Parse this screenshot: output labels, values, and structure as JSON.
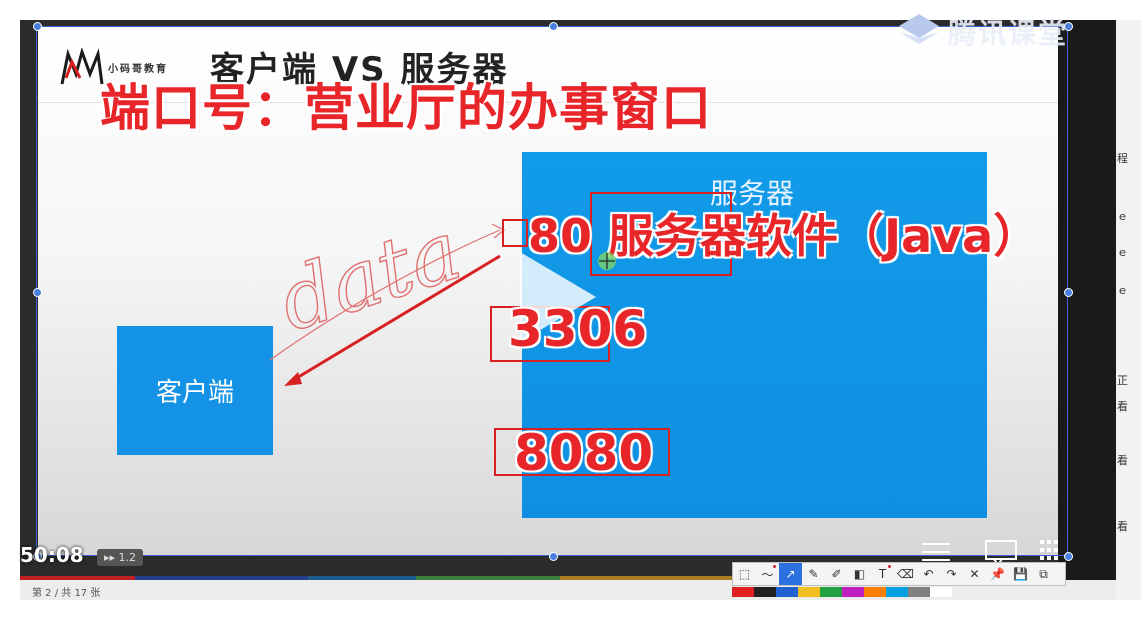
{
  "brand": {
    "name": "腾讯课堂"
  },
  "slide": {
    "logo_text": "小码哥教育",
    "title": "客户端 VS 服务器",
    "client_label": "客户端",
    "server_label": "服务器",
    "handwriting": "data"
  },
  "annotations": {
    "heading": "端口号：营业厅的办事窗口",
    "port_80": "80 服务器软件（Java）",
    "port_3306": "3306",
    "port_8080": "8080"
  },
  "player": {
    "time": "50:08",
    "speed": "▸▸ 1.2",
    "page": "第 2 / 共 17 张"
  },
  "toolbar": {
    "tools": [
      {
        "name": "select-tool",
        "glyph": "⬚"
      },
      {
        "name": "curve-tool",
        "glyph": "〜"
      },
      {
        "name": "arrow-tool",
        "glyph": "↗"
      },
      {
        "name": "pen-tool",
        "glyph": "✎"
      },
      {
        "name": "highlighter-tool",
        "glyph": "✐"
      },
      {
        "name": "shape-tool",
        "glyph": "◧"
      },
      {
        "name": "text-tool",
        "glyph": "T"
      },
      {
        "name": "eraser-tool",
        "glyph": "⌫"
      },
      {
        "name": "undo-tool",
        "glyph": "↶"
      },
      {
        "name": "redo-tool",
        "glyph": "↷"
      },
      {
        "name": "close-tool",
        "glyph": "✕"
      },
      {
        "name": "pin-tool",
        "glyph": "📌"
      },
      {
        "name": "save-tool",
        "glyph": "💾"
      },
      {
        "name": "copy-tool",
        "glyph": "⧉"
      }
    ],
    "palette": [
      "#e02020",
      "#222222",
      "#2060d0",
      "#f0c020",
      "#20a040",
      "#c020c0",
      "#ff8000",
      "#00a0e0",
      "#808080",
      "#ffffff"
    ]
  },
  "colors": {
    "annotation_red": "#e8262a",
    "client_blue": "#1493e6",
    "server_blue": "#119be8",
    "selection_blue": "#3a63d6"
  }
}
